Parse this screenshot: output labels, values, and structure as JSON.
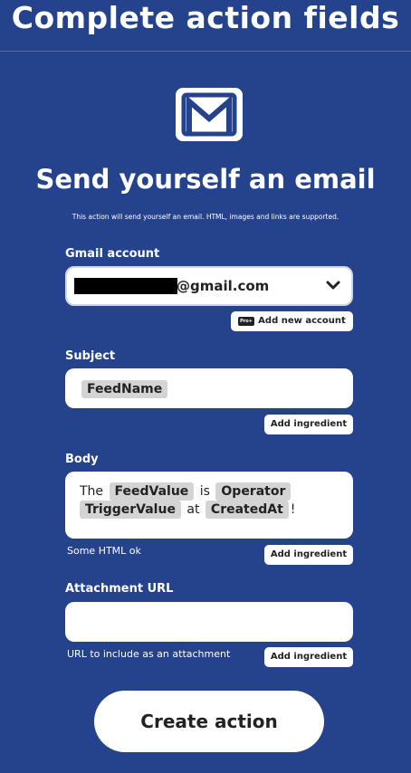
{
  "header": {
    "title": "Complete action fields"
  },
  "service": {
    "icon": "gmail-m-icon",
    "accent_color": "#25428c"
  },
  "action": {
    "title": "Send yourself an email",
    "description": "This action will send yourself an email. HTML, images and links are supported."
  },
  "fields": {
    "gmail_account": {
      "label": "Gmail account",
      "value_suffix": "@gmail.com",
      "add_button": "Add new account",
      "pro_badge": "Pro+"
    },
    "subject": {
      "label": "Subject",
      "tokens": [
        "FeedName"
      ],
      "add_button": "Add ingredient"
    },
    "body": {
      "label": "Body",
      "text_the": "The",
      "token_feed_value": "FeedValue",
      "text_is": "is",
      "token_operator": "Operator",
      "token_trigger_value": "TriggerValue",
      "text_at": "at",
      "token_created_at": "CreatedAt",
      "text_end": "!",
      "helper": "Some HTML ok",
      "add_button": "Add ingredient"
    },
    "attachment_url": {
      "label": "Attachment URL",
      "value": "",
      "helper": "URL to include as an attachment",
      "add_button": "Add ingredient"
    }
  },
  "submit": {
    "label": "Create action"
  }
}
